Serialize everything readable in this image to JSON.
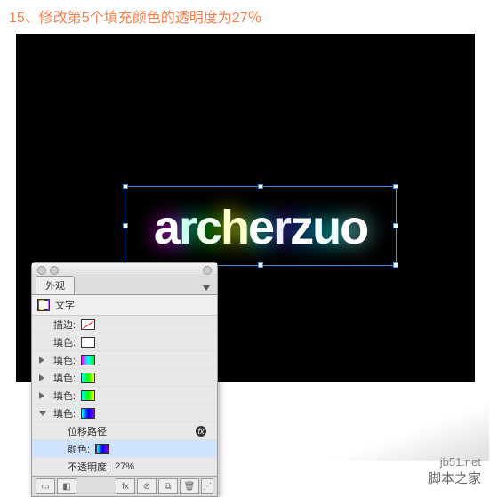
{
  "caption": "15、修改第5个填充颜色的透明度为27％",
  "artwork_text": "archerzuo",
  "panel": {
    "tab": "外观",
    "header": "文字",
    "rows": {
      "stroke": "描边:",
      "fill": "填色:",
      "offset": "位移路径",
      "color": "颜色:",
      "opacity_label": "不透明度:",
      "opacity_value": "27%"
    }
  },
  "watermark": {
    "site": "jb51.net",
    "name": "脚本之家"
  }
}
